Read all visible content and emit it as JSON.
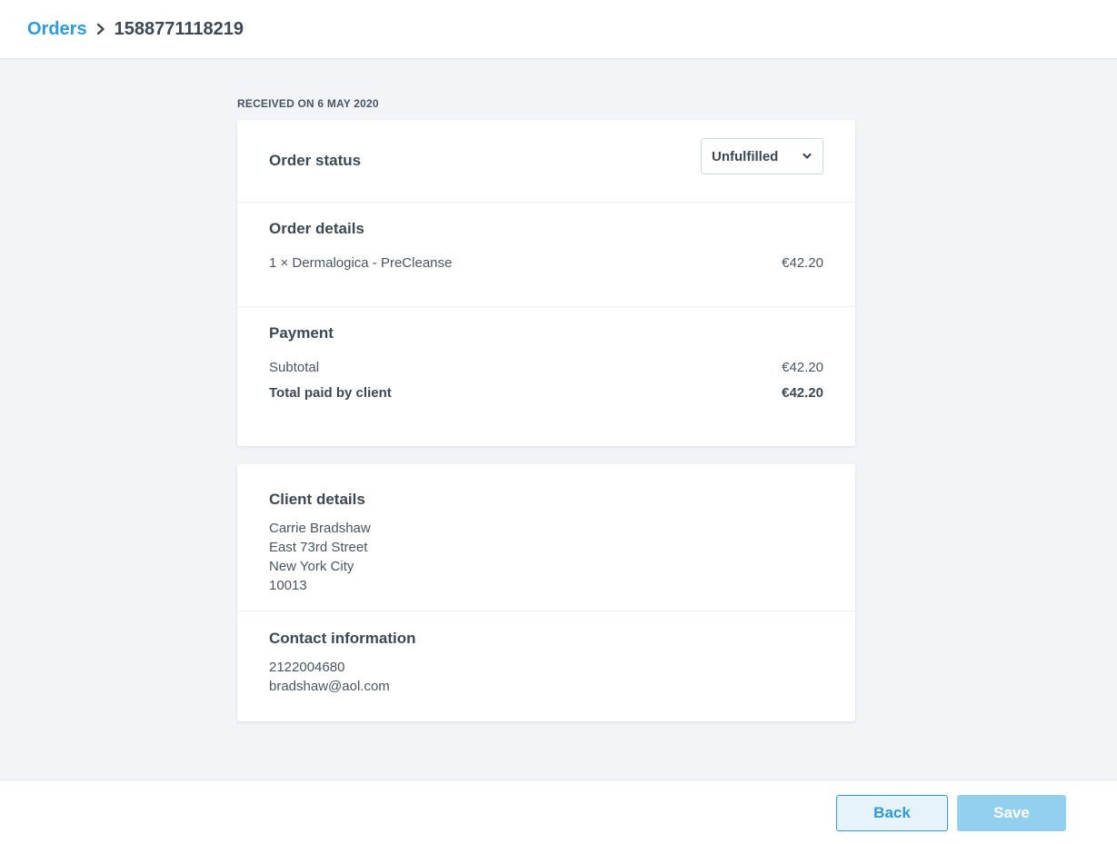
{
  "breadcrumb": {
    "parent": "Orders",
    "current": "1588771118219"
  },
  "received_label": "RECEIVED ON 6 MAY 2020",
  "order_status": {
    "title": "Order status",
    "selected": "Unfulfilled"
  },
  "order_details": {
    "title": "Order details",
    "items": [
      {
        "description": "1 × Dermalogica - PreCleanse",
        "price": "€42.20"
      }
    ]
  },
  "payment": {
    "title": "Payment",
    "subtotal_label": "Subtotal",
    "subtotal_value": "€42.20",
    "total_label": "Total paid by client",
    "total_value": "€42.20"
  },
  "client_details": {
    "title": "Client details",
    "lines": [
      "Carrie Bradshaw",
      "East 73rd Street",
      "New York City",
      "10013"
    ]
  },
  "contact_information": {
    "title": "Contact information",
    "lines": [
      "2122004680",
      "bradshaw@aol.com"
    ]
  },
  "footer": {
    "back_label": "Back",
    "save_label": "Save"
  },
  "colors": {
    "accent": "#2e9bd6",
    "save_disabled": "#93cfee",
    "background": "#f2f4f7"
  },
  "icons": {
    "breadcrumb_separator": "chevron-right-icon",
    "select_arrow": "chevron-down-icon"
  }
}
